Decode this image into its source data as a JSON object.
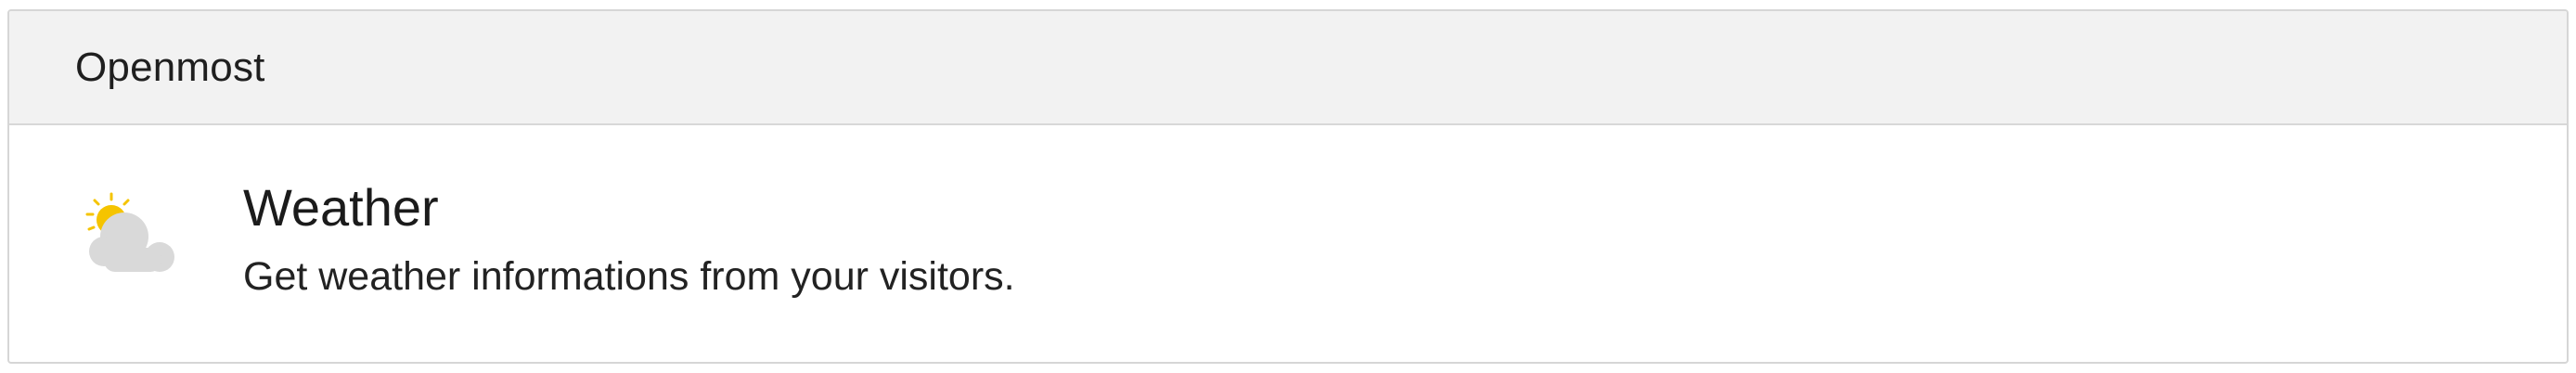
{
  "header": {
    "title": "Openmost"
  },
  "plugin": {
    "icon": "partly-cloudy-icon",
    "title": "Weather",
    "description": "Get weather informations from your visitors."
  },
  "colors": {
    "header_background": "#f2f2f2",
    "border": "#d6d6d6",
    "sun": "#f5c400",
    "cloud": "#d9d9d9"
  }
}
